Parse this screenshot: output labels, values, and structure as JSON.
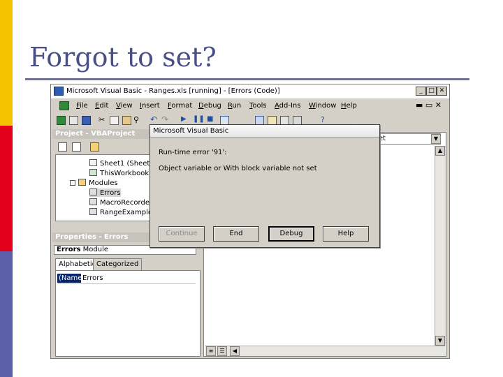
{
  "slide": {
    "title": "Forgot to set?"
  },
  "window": {
    "title": "Microsoft Visual Basic - Ranges.xls [running] - [Errors (Code)]",
    "menu": [
      "File",
      "Edit",
      "View",
      "Insert",
      "Format",
      "Debug",
      "Run",
      "Tools",
      "Add-Ins",
      "Window",
      "Help"
    ]
  },
  "project_pane": {
    "title": "Project - VBAProject",
    "tree": [
      {
        "label": "Sheet1 (Sheet1)"
      },
      {
        "label": "ThisWorkbook"
      },
      {
        "label": "Modules"
      },
      {
        "label": "Errors"
      },
      {
        "label": "MacroRecorded"
      },
      {
        "label": "RangeExample"
      }
    ]
  },
  "properties_pane": {
    "title": "Properties - Errors",
    "object_name": "Errors",
    "object_type": "Module",
    "tabs": [
      "Alphabetic",
      "Categorized"
    ],
    "rows": [
      {
        "name": "(Name)",
        "value": "Errors"
      }
    ]
  },
  "code_pane": {
    "procedure_combo_fragment": "et"
  },
  "dialog": {
    "title": "Microsoft Visual Basic",
    "error_line": "Run-time error '91':",
    "message": "Object variable or With block variable not set",
    "buttons": {
      "continue": "Continue",
      "end": "End",
      "debug": "Debug",
      "help": "Help"
    }
  },
  "colors": {
    "accent_yellow": "#f5c400",
    "accent_red": "#e2001a",
    "accent_blue": "#5b5ea8",
    "title_color": "#4a4f86"
  }
}
